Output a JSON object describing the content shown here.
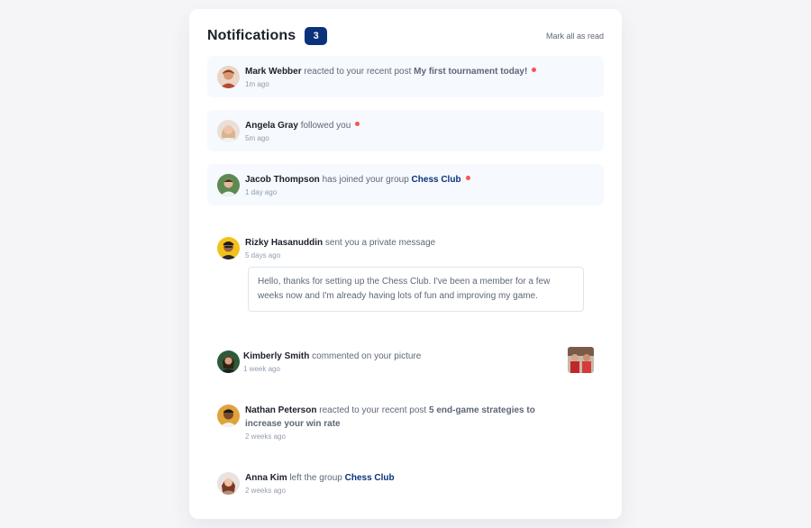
{
  "header": {
    "title": "Notifications",
    "unread_count": "3",
    "mark_all_label": "Mark all as read"
  },
  "colors": {
    "brand_blue": "#0a327b",
    "unread_bg": "#f6f9fd",
    "dot_red": "#f65552",
    "text_dark": "#1c202b",
    "text_muted": "#5e6778"
  },
  "notifications": [
    {
      "actor": "Mark Webber",
      "action": "reacted to your recent post",
      "post": "My first tournament today!",
      "time": "1m ago",
      "unread": true,
      "avatar": "avatar-mark-webber"
    },
    {
      "actor": "Angela Gray",
      "action": "followed you",
      "time": "5m ago",
      "unread": true,
      "avatar": "avatar-angela-gray"
    },
    {
      "actor": "Jacob Thompson",
      "action": "has joined your group",
      "group": "Chess Club",
      "time": "1 day ago",
      "unread": true,
      "avatar": "avatar-jacob-thompson"
    },
    {
      "actor": "Rizky Hasanuddin",
      "action": "sent you a private message",
      "time": "5 days ago",
      "unread": false,
      "message": "Hello, thanks for setting up the Chess Club. I've been a member for a few weeks now and I'm already having lots of fun and improving my game.",
      "avatar": "avatar-rizky-hasanuddin"
    },
    {
      "actor": "Kimberly Smith",
      "action": "commented on your picture",
      "time": "1 week ago",
      "unread": false,
      "avatar": "avatar-kimberly-smith",
      "thumbnail": "chess-picture-thumbnail"
    },
    {
      "actor": "Nathan Peterson",
      "action": "reacted to your recent post",
      "post": "5 end-game strategies to increase your win rate",
      "time": "2 weeks ago",
      "unread": false,
      "avatar": "avatar-nathan-peterson"
    },
    {
      "actor": "Anna Kim",
      "action": "left the group",
      "group": "Chess Club",
      "time": "2 weeks ago",
      "unread": false,
      "avatar": "avatar-anna-kim"
    }
  ]
}
